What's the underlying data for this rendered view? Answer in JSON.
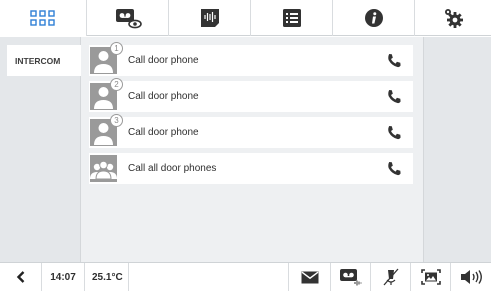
{
  "topbar": {
    "tabs": [
      {
        "name": "apps",
        "icon": "grid-icon",
        "active": true
      },
      {
        "name": "video-messages",
        "icon": "video-eye-icon"
      },
      {
        "name": "audio-messages",
        "icon": "voice-message-icon"
      },
      {
        "name": "list",
        "icon": "list-icon"
      },
      {
        "name": "info",
        "icon": "info-icon"
      },
      {
        "name": "settings",
        "icon": "gears-icon"
      }
    ]
  },
  "sidebar": {
    "items": [
      {
        "label": "INTERCOM"
      }
    ]
  },
  "calls": [
    {
      "label": "Call door phone",
      "badge": "1",
      "icon": "person-icon"
    },
    {
      "label": "Call door phone",
      "badge": "2",
      "icon": "person-icon"
    },
    {
      "label": "Call door phone",
      "badge": "3",
      "icon": "person-icon"
    },
    {
      "label": "Call all door phones",
      "badge": "",
      "icon": "people-icon"
    }
  ],
  "bottombar": {
    "time": "14:07",
    "temperature": "25.1°C"
  },
  "colors": {
    "accent": "#2f7fd6",
    "icon_dark": "#333333",
    "avatar_grey": "#9a9a9a",
    "panel_bg": "#eef0f2",
    "side_bg": "#e4e7ea"
  }
}
